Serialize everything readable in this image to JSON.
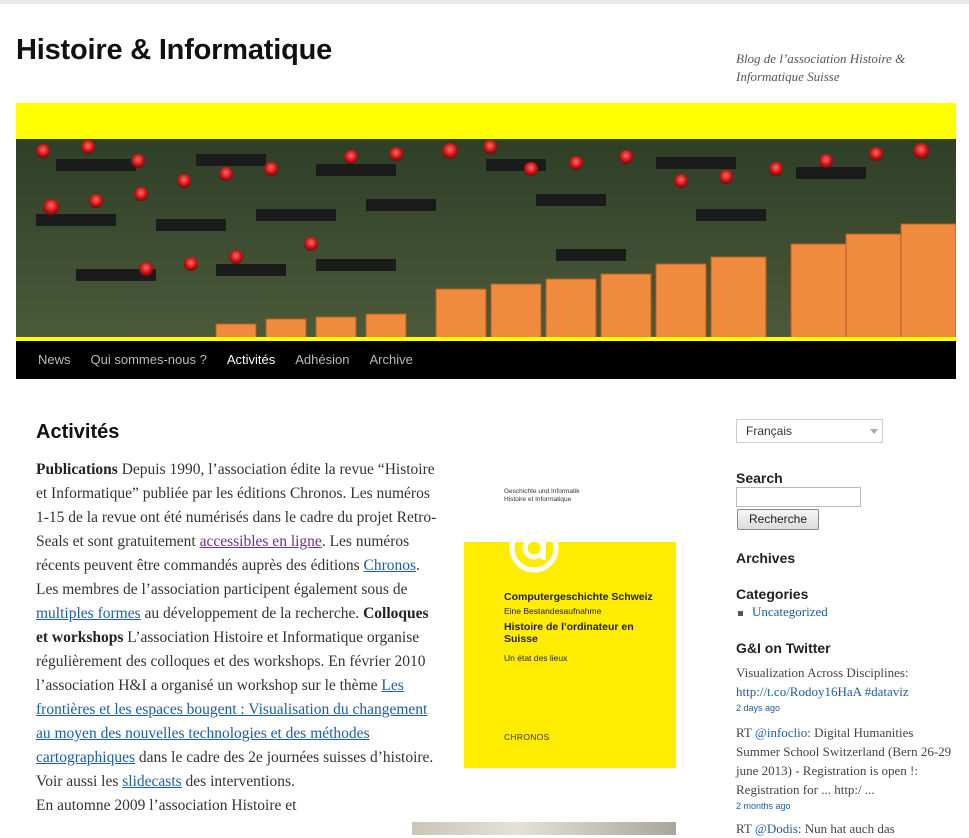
{
  "site": {
    "title": "Histoire & Informatique",
    "description": "Blog de l’association Histoire & Informatique Suisse"
  },
  "nav": [
    {
      "label": "News",
      "active": false
    },
    {
      "label": "Qui sommes-nous ?",
      "active": false
    },
    {
      "label": "Activités",
      "active": true
    },
    {
      "label": "Adhésion",
      "active": false
    },
    {
      "label": "Archive",
      "active": false
    }
  ],
  "page": {
    "title": "Activités",
    "p1_h": "Publications",
    "p1_a": " Depuis 1990, l’association édite la revue “Histoire et Informatique” publiée par les éditions Chronos. Les numéros 1-15 de la revue ont été numérisés dans le cadre du projet Retro-Seals et sont gratuitement ",
    "link_accessibles": "accessibles en ligne",
    "p1_b": ". Les numéros récents peuvent être commandés auprès des éditions ",
    "link_chronos": "Chronos",
    "p1_c": ". Les membres de l’association participent également sous de ",
    "link_multiples": "multiples formes",
    "p1_d": " au développement de la recherche. ",
    "p2_h": "Colloques et workshops",
    "p2_a": " L’association Histoire et Informatique organise régulièrement des colloques et des workshops. En février 2010 l’association H&I a organisé un workshop sur le thème ",
    "link_frontieres": "Les frontières et les espaces bougent : Visualisation du changement au moyen des nouvelles technologies et des méthodes cartographiques",
    "p2_b": " dans le cadre des 2e journées suisses d’histoire. Voir aussi les ",
    "link_slidecasts": "slidecasts",
    "p2_c": " des interventions.",
    "p3": "En automne 2009 l’association Histoire et"
  },
  "book": {
    "header_line1": "Geschichte und Informatik",
    "header_line2": "Histoire et Informatique",
    "title1": "Computergeschichte Schweiz",
    "title2": "Eine Bestandesaufnahme",
    "title3": "Histoire de l'ordinateur en Suisse",
    "title4": "Un état des lieux",
    "publisher": "CHRONOS"
  },
  "sidebar": {
    "language": "Français",
    "search_title": "Search",
    "search_button": "Recherche",
    "archives_title": "Archives",
    "categories_title": "Categories",
    "category_item": "Uncategorized",
    "twitter_title": "G&I on Twitter",
    "tweets": [
      {
        "pre": "Visualization Across Disciplines: ",
        "link": "http://t.co/Rodoy16HaA",
        "post": " ",
        "tag": "#dataviz",
        "time": "2 days ago"
      },
      {
        "pre": "RT ",
        "link": "@infoclio",
        "post": ": Digital Humanities Summer School Switzerland (Bern 26-29 june 2013) - Registration is open !: Registration for ... http:/ ...",
        "tag": "",
        "time": "2 months ago"
      },
      {
        "pre": "RT ",
        "link": "@Dodis",
        "post": ": Nun hat auch das",
        "tag": "",
        "time": ""
      }
    ]
  },
  "colors": {
    "accent_yellow": "#ffff00",
    "nav_bg": "#000000",
    "link": "#1b5cb1",
    "visited": "#6b2d91"
  }
}
